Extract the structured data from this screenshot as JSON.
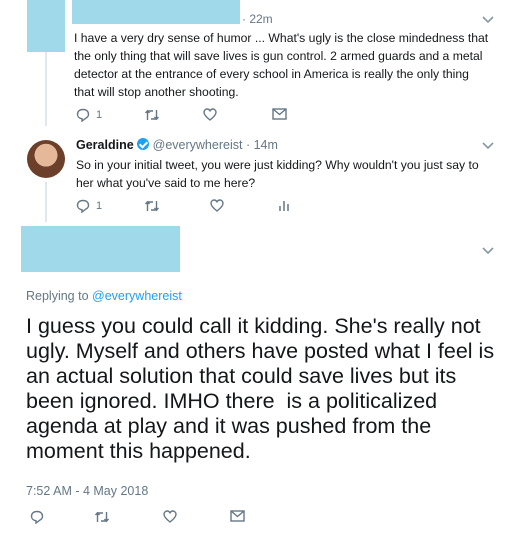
{
  "reply1": {
    "timestamp": "· 22m",
    "text": "I have a very dry sense of humor ... What's ugly is the close mindedness that the only thing that will save lives is gun control. 2 armed guards and a metal detector at the entrance of every school in America is really the only thing that will stop another shooting.",
    "reply_count": "1"
  },
  "reply2": {
    "name": "Geraldine",
    "handle": "@everywhereist",
    "timestamp": "· 14m",
    "text": "So in your initial tweet, you were just kidding? Why wouldn't you just say to her what you've said to me here?",
    "reply_count": "1"
  },
  "main": {
    "replying_to_label": "Replying to",
    "replying_to_handle": "@everywhereist",
    "text": "I guess you could call it kidding. She's really not ugly. Myself and others have posted what I feel is an actual solution that could save lives but its been ignored. IMHO there  is a politicalized agenda at play and it was pushed from the moment this happened.",
    "datetime": "7:52 AM - 4 May 2018"
  },
  "icons": {
    "reply": "reply-icon",
    "retweet": "retweet-icon",
    "like": "heart-icon",
    "dm": "envelope-icon",
    "analytics": "analytics-icon",
    "caret": "chevron-down-icon"
  },
  "colors": {
    "accent": "#1da1f2",
    "muted": "#657786",
    "redaction": "#9fd9ea"
  }
}
